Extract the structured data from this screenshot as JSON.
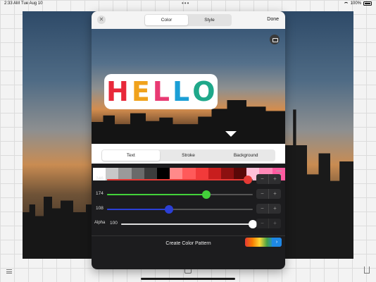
{
  "status_bar": {
    "time": "2:33 AM",
    "date": "Tue Aug 10",
    "battery": "100%"
  },
  "modal": {
    "tabs": [
      "Color",
      "Style"
    ],
    "active_tab": "Color",
    "done_label": "Done",
    "close_glyph": "✕"
  },
  "preview": {
    "letters": [
      {
        "char": "H",
        "color": "#e8283a"
      },
      {
        "char": "E",
        "color": "#f0a21c"
      },
      {
        "char": "L",
        "color": "#e83a73"
      },
      {
        "char": "L",
        "color": "#1b9fd6"
      },
      {
        "char": "O",
        "color": "#1fa88a"
      }
    ]
  },
  "target_tabs": [
    "Text",
    "Stroke",
    "Background"
  ],
  "active_target": "Text",
  "swatches": [
    "#ffffff",
    "#c8c8c8",
    "#9a9a9a",
    "#6a6a6a",
    "#3c3c3c",
    "#000000",
    "#ff8a8a",
    "#ff5a5a",
    "#f23a3a",
    "#c81e1e",
    "#8c1010",
    "#5a0808",
    "#ffc0d8",
    "#ff8ab8",
    "#ff5aa0",
    "#ff2a88"
  ],
  "sliders": [
    {
      "label": "246",
      "value": 246,
      "max": 255,
      "color": "#e53935"
    },
    {
      "label": "174",
      "value": 174,
      "max": 255,
      "color": "#43d13a"
    },
    {
      "label": "108",
      "value": 108,
      "max": 255,
      "color": "#2b3fd6"
    }
  ],
  "alpha": {
    "label": "Alpha",
    "value": "100",
    "fraction": 1.0
  },
  "stepper": {
    "minus": "−",
    "plus": "+"
  },
  "pattern": {
    "label": "Create Color Pattern",
    "arrow": "›"
  }
}
